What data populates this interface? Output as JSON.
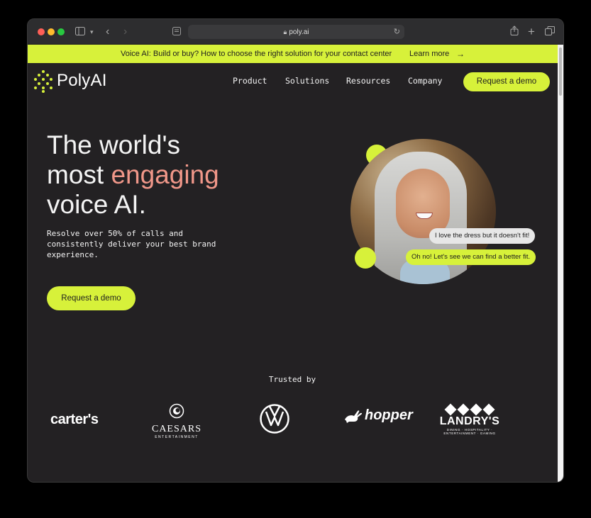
{
  "browser": {
    "url": "poly.ai",
    "icons": [
      "sidebar-icon",
      "chevron-down-icon",
      "back-icon",
      "forward-icon",
      "reader-icon",
      "lock-icon",
      "reload-icon",
      "share-icon",
      "new-tab-icon",
      "tabs-icon"
    ]
  },
  "banner": {
    "text": "Voice AI: Build or buy? How to choose the right solution for your contact center",
    "cta": "Learn more",
    "arrow": "→"
  },
  "nav": {
    "logo": "PolyAI",
    "links": [
      "Product",
      "Solutions",
      "Resources",
      "Company"
    ],
    "cta": "Request a demo"
  },
  "hero": {
    "title_line1": "The world's",
    "title_line2_a": "most ",
    "title_line2_b": "engaging",
    "title_line3": "voice AI.",
    "subtitle": "Resolve over 50% of calls and consistently deliver your best brand experience.",
    "cta": "Request a demo",
    "bubble_user": "I love the dress but it doesn't fit!",
    "bubble_agent": "Oh no! Let's see we can find a better fit."
  },
  "trusted": {
    "heading": "Trusted by",
    "brands": {
      "carters": "carter's",
      "caesars": "CAESARS",
      "caesars_sub": "ENTERTAINMENT",
      "hopper": "hopper",
      "landrys": "LANDRY'S",
      "landrys_sub": "DINING · HOSPITALITY · ENTERTAINMENT · GAMING"
    }
  },
  "colors": {
    "accent": "#d7f13a",
    "highlight": "#f09789",
    "background": "#232123"
  }
}
